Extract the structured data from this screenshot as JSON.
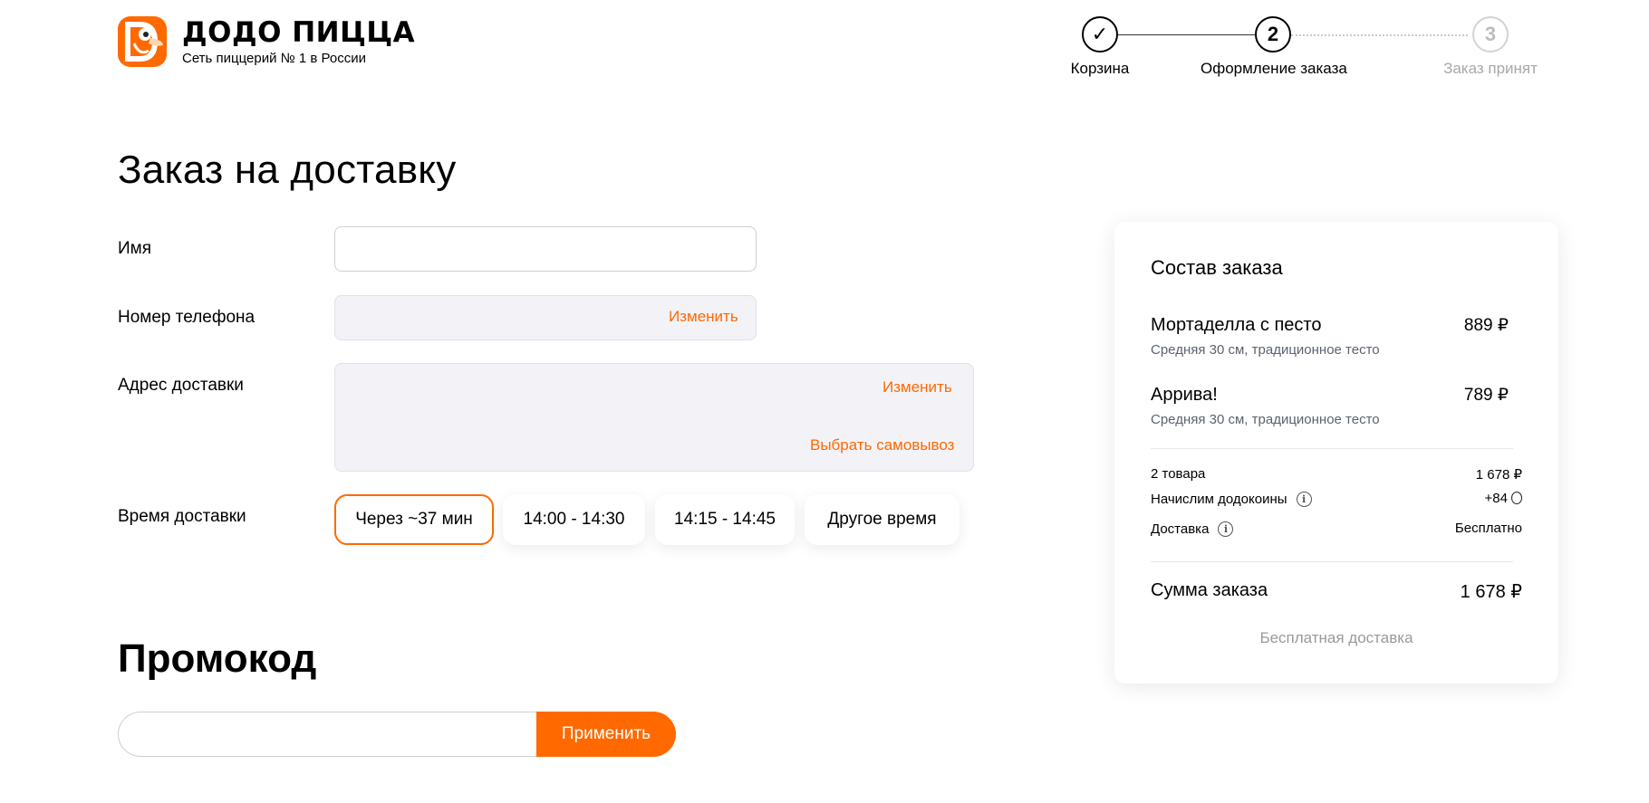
{
  "brand": {
    "title": "ДОДО ПИЦЦА",
    "subtitle": "Сеть пиццерий № 1 в России",
    "accent": "#ff6900"
  },
  "stepper": {
    "steps": [
      {
        "number": "✓",
        "label": "Корзина",
        "state": "done"
      },
      {
        "number": "2",
        "label": "Оформление заказа",
        "state": "active"
      },
      {
        "number": "3",
        "label": "Заказ принят",
        "state": "inactive"
      }
    ]
  },
  "form": {
    "title": "Заказ на доставку",
    "name_label": "Имя",
    "name_value": "",
    "phone_label": "Номер телефона",
    "phone_value": "",
    "phone_change": "Изменить",
    "address_label": "Адрес доставки",
    "address_value": "",
    "address_change": "Изменить",
    "pickup_link": "Выбрать самовывоз",
    "time_label": "Время доставки",
    "time_options": [
      "Через ~37 мин",
      "14:00 - 14:30",
      "14:15 - 14:45",
      "Другое время"
    ],
    "time_selected": "Через ~37 мин"
  },
  "promo": {
    "title": "Промокод",
    "input_value": "",
    "apply_label": "Применить"
  },
  "order": {
    "title": "Состав заказа",
    "items": [
      {
        "name": "Мортаделла с песто",
        "desc": "Средняя 30 см, традиционное тесто",
        "price": "889 ₽"
      },
      {
        "name": "Аррива!",
        "desc": "Средняя 30 см, традиционное тесто",
        "price": "789 ₽"
      }
    ],
    "count_label": "2 товара",
    "count_value": "1 678 ₽",
    "coins_label": "Начислим додокоины",
    "coins_value": "+84",
    "delivery_label": "Доставка",
    "delivery_value": "Бесплатно",
    "total_label": "Сумма заказа",
    "total_value": "1 678 ₽",
    "free_note": "Бесплатная доставка"
  }
}
